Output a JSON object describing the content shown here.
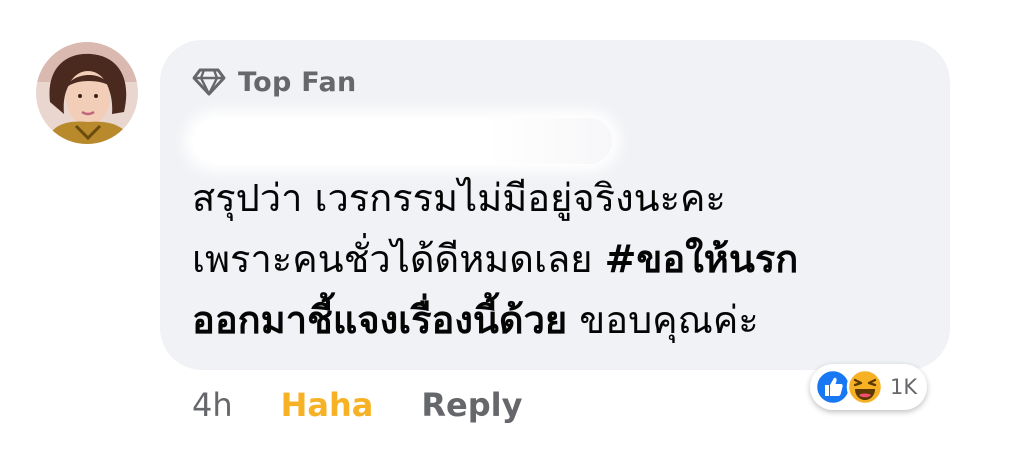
{
  "comment": {
    "badge": {
      "icon": "diamond-icon",
      "label": "Top Fan"
    },
    "author": {
      "name": ""
    },
    "text_lines": [
      [
        "สรุปว่า เวรกรรมไม่มีอยู่จริงนะคะ"
      ],
      [
        "เพราะคนชั่วได้ดีหมดเลย ",
        "#ขอให้นรก"
      ],
      [
        "ออกมาชี้แจงเรื่องนี้ด้วย",
        " ขอบคุณค่ะ"
      ]
    ]
  },
  "reactions": {
    "icons": [
      "like-reaction-icon",
      "haha-reaction-icon"
    ],
    "count": "1K",
    "colors": {
      "like": "#1877f2",
      "haha": "#f7b125"
    }
  },
  "actions": {
    "time": "4h",
    "reaction_label": "Haha",
    "reply_label": "Reply"
  },
  "colors": {
    "bubble": "#f0f2f5",
    "secondary_text": "#65676b",
    "haha_active": "#f7b125"
  }
}
